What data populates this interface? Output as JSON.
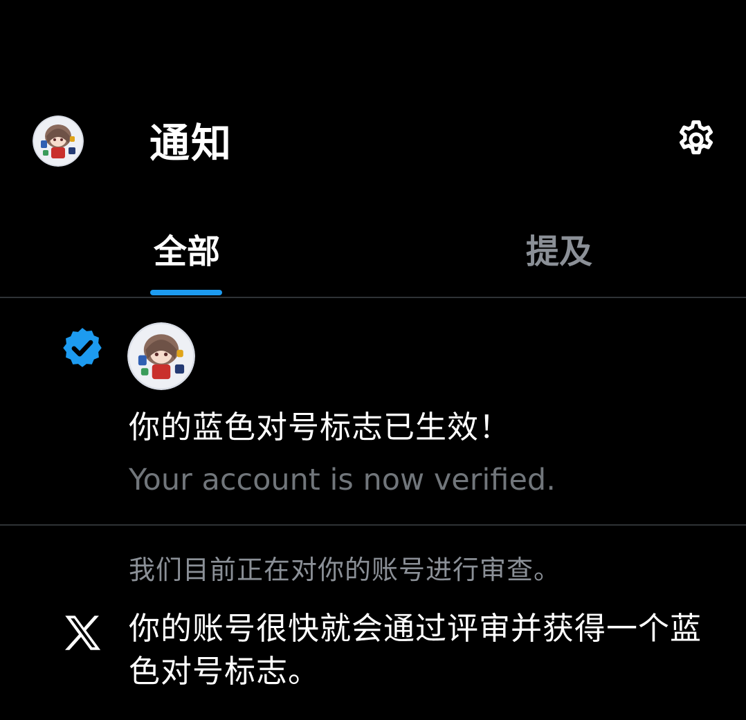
{
  "header": {
    "title": "通知",
    "avatar_icon": "user-avatar-icon",
    "settings_icon": "gear-icon"
  },
  "tabs": [
    {
      "label": "全部",
      "selected": true
    },
    {
      "label": "提及",
      "selected": false
    }
  ],
  "notifications": [
    {
      "icon": "verified-badge-icon",
      "title": "你的蓝色对号标志已生效！",
      "subtitle": "Your account is now verified."
    },
    {
      "icon": "x-logo-icon",
      "line1": "我们目前正在对你的账号进行审查。",
      "body": "你的账号很快就会通过评审并获得一个蓝色对号标志。"
    }
  ],
  "colors": {
    "background": "#000000",
    "accent": "#1d9bf0",
    "text_primary": "#ffffff",
    "text_secondary": "#71767b",
    "divider": "#2f3336"
  }
}
